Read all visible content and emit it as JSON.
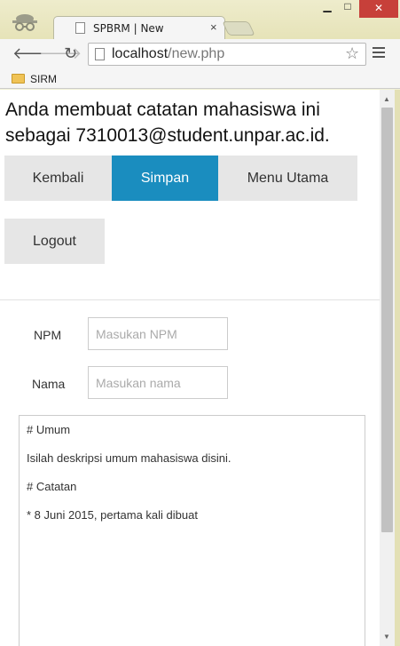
{
  "browser": {
    "tab_title": "SPBRM | New",
    "tab_close": "×",
    "window_buttons": {
      "minimize": "▁",
      "maximize": "□",
      "close": "✕"
    },
    "url_host": "localhost",
    "url_path": "/new.php",
    "star": "☆",
    "bookmark_label": "SIRM",
    "icons": [
      "incognito-icon",
      "page-icon",
      "back-icon",
      "forward-icon",
      "reload-icon",
      "star-icon",
      "menu-icon",
      "folder-icon"
    ]
  },
  "page": {
    "intro": "Anda membuat catatan mahasiswa ini sebagai 7310013@student.unpar.ac.id.",
    "nav": {
      "kembali": "Kembali",
      "simpan": "Simpan",
      "menu_utama": "Menu Utama",
      "logout": "Logout"
    },
    "form": {
      "npm_label": "NPM",
      "npm_placeholder": "Masukan NPM",
      "nama_label": "Nama",
      "nama_placeholder": "Masukan nama"
    },
    "notes": [
      "# Umum",
      "Isilah deskripsi umum mahasiswa disini.",
      "# Catatan",
      "* 8 Juni 2015, pertama kali dibuat"
    ]
  },
  "colors": {
    "accent": "#1a8dbf",
    "nav_bg": "#e6e6e6",
    "chrome_frame": "#eeeccc"
  }
}
